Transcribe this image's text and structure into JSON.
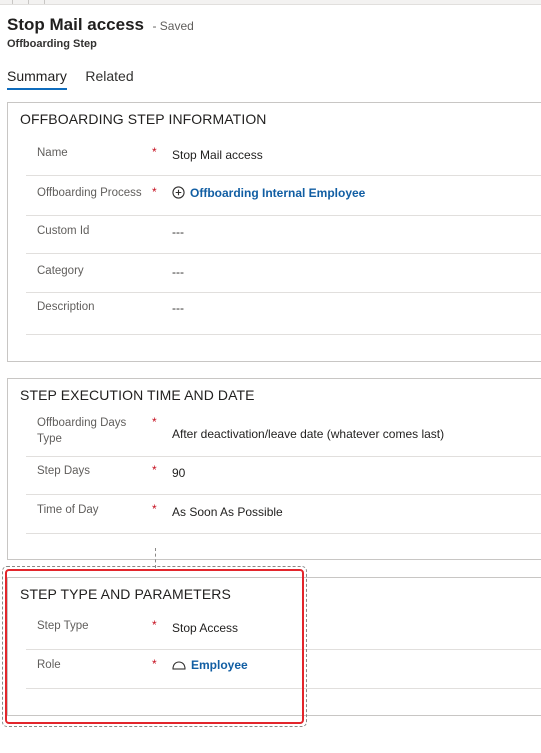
{
  "header": {
    "title": "Stop Mail access",
    "saved": "- Saved",
    "subtitle": "Offboarding Step"
  },
  "tabs": [
    {
      "label": "Summary",
      "active": true
    },
    {
      "label": "Related",
      "active": false
    }
  ],
  "sections": {
    "info": {
      "title": "OFFBOARDING STEP INFORMATION",
      "fields": {
        "name": {
          "label": "Name",
          "required": "*",
          "value": "Stop Mail access"
        },
        "process": {
          "label": "Offboarding Process",
          "required": "*",
          "value": "Offboarding Internal Employee"
        },
        "custom_id": {
          "label": "Custom Id",
          "value": "---"
        },
        "category": {
          "label": "Category",
          "value": "---"
        },
        "description": {
          "label": "Description",
          "value": "---"
        }
      }
    },
    "execution": {
      "title": "STEP EXECUTION TIME AND DATE",
      "fields": {
        "days_type": {
          "label": "Offboarding Days Type",
          "required": "*",
          "value": "After deactivation/leave date (whatever comes last)"
        },
        "step_days": {
          "label": "Step Days",
          "required": "*",
          "value": "90"
        },
        "time_of_day": {
          "label": "Time of Day",
          "required": "*",
          "value": "As Soon As Possible"
        }
      }
    },
    "type": {
      "title": "STEP TYPE AND PARAMETERS",
      "fields": {
        "step_type": {
          "label": "Step Type",
          "required": "*",
          "value": "Stop Access"
        },
        "role": {
          "label": "Role",
          "required": "*",
          "value": "Employee"
        }
      }
    }
  },
  "colors": {
    "accent": "#0f6cbd",
    "link": "#115ea3",
    "required": "#c50f1f",
    "highlight": "#e3262c"
  }
}
